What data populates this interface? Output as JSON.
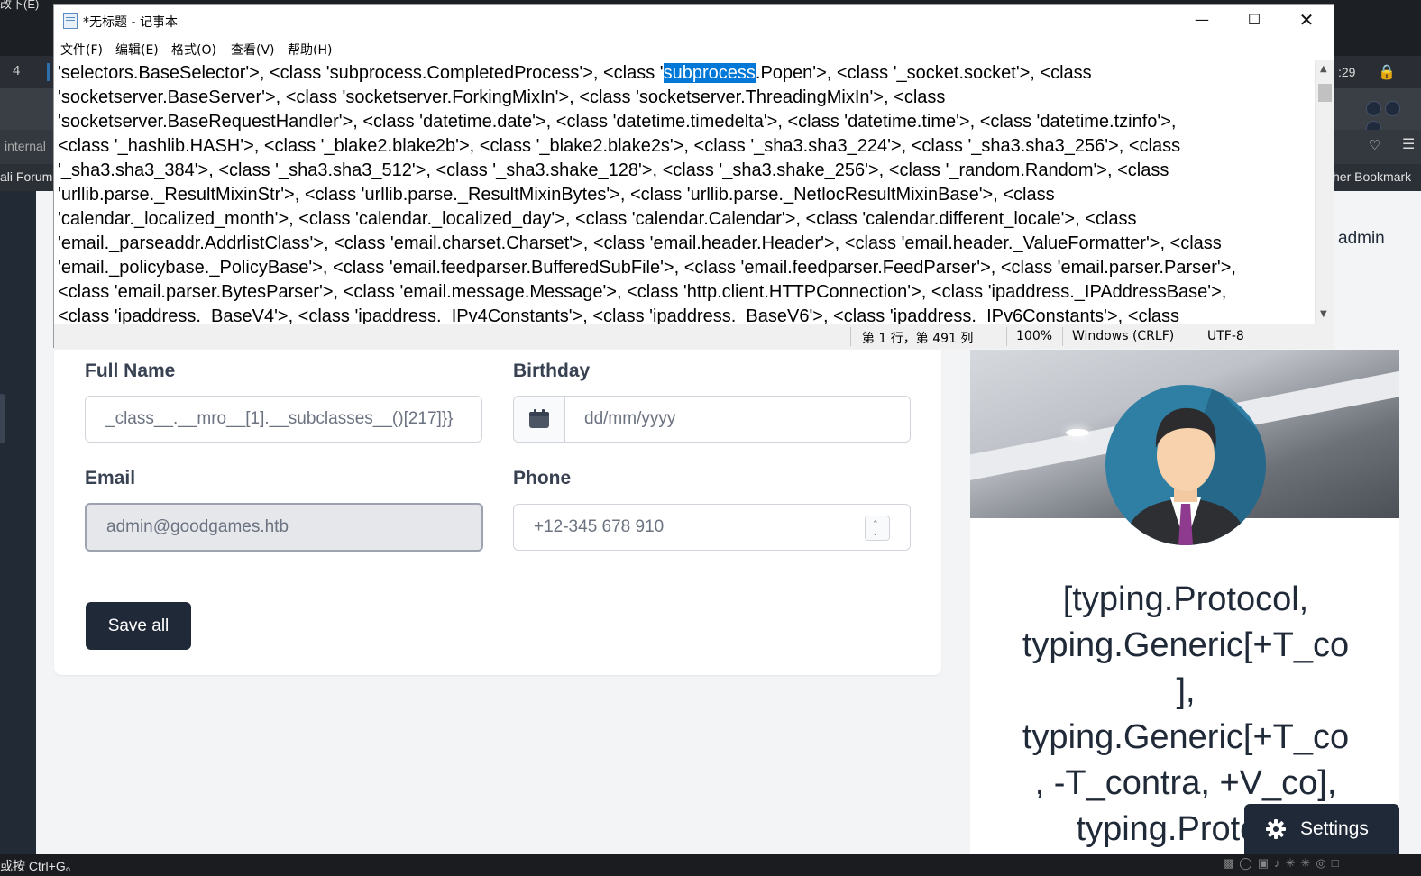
{
  "background_browser": {
    "top_fragment": "改下(E)",
    "tab_number": "4",
    "clock_fragment": ":29",
    "url_fragment": "internal",
    "bookmark_left": "ali Forum",
    "bookmark_right": "her Bookmark",
    "admin_label": "admin",
    "status_hint": "或按 Ctrl+G。"
  },
  "profile_form": {
    "full_name": {
      "label": "Full Name",
      "value": "_class__.__mro__[1].__subclasses__()[217]}}"
    },
    "birthday": {
      "label": "Birthday",
      "placeholder": "dd/mm/yyyy"
    },
    "email": {
      "label": "Email",
      "value": "admin@goodgames.htb"
    },
    "phone": {
      "label": "Phone",
      "value": "+12-345 678 910"
    },
    "save_label": "Save all"
  },
  "profile_card": {
    "lines": [
      "[typing.Protocol,",
      "typing.Generic[+T_co",
      "],",
      "typing.Generic[+T_co",
      ", -T_contra, +V_co],",
      "typing.Protoco"
    ]
  },
  "settings_label": "Settings",
  "notepad": {
    "title": "*无标题 - 记事本",
    "menu": [
      "文件(F)",
      "编辑(E)",
      "格式(O)",
      "查看(V)",
      "帮助(H)"
    ],
    "lines": [
      {
        "before": "'selectors.BaseSelector'>, <class 'subprocess.CompletedProcess'>, <class '",
        "selected": "subprocess",
        "after": ".Popen'>, <class '_socket.socket'>, <class"
      },
      {
        "before": "'socketserver.BaseServer'>, <class 'socketserver.ForkingMixIn'>, <class 'socketserver.ThreadingMixIn'>, <class",
        "selected": "",
        "after": ""
      },
      {
        "before": "'socketserver.BaseRequestHandler'>, <class 'datetime.date'>, <class 'datetime.timedelta'>, <class 'datetime.time'>, <class 'datetime.tzinfo'>,",
        "selected": "",
        "after": ""
      },
      {
        "before": "<class '_hashlib.HASH'>, <class '_blake2.blake2b'>, <class '_blake2.blake2s'>, <class '_sha3.sha3_224'>, <class '_sha3.sha3_256'>, <class",
        "selected": "",
        "after": ""
      },
      {
        "before": "'_sha3.sha3_384'>, <class '_sha3.sha3_512'>, <class '_sha3.shake_128'>, <class '_sha3.shake_256'>, <class '_random.Random'>, <class",
        "selected": "",
        "after": ""
      },
      {
        "before": "'urllib.parse._ResultMixinStr'>, <class 'urllib.parse._ResultMixinBytes'>, <class 'urllib.parse._NetlocResultMixinBase'>, <class",
        "selected": "",
        "after": ""
      },
      {
        "before": "'calendar._localized_month'>, <class 'calendar._localized_day'>, <class 'calendar.Calendar'>, <class 'calendar.different_locale'>, <class",
        "selected": "",
        "after": ""
      },
      {
        "before": "'email._parseaddr.AddrlistClass'>, <class 'email.charset.Charset'>, <class 'email.header.Header'>, <class 'email.header._ValueFormatter'>, <class",
        "selected": "",
        "after": ""
      },
      {
        "before": "'email._policybase._PolicyBase'>, <class 'email.feedparser.BufferedSubFile'>, <class 'email.feedparser.FeedParser'>, <class 'email.parser.Parser'>,",
        "selected": "",
        "after": ""
      },
      {
        "before": "<class 'email.parser.BytesParser'>, <class 'email.message.Message'>, <class 'http.client.HTTPConnection'>, <class 'ipaddress._IPAddressBase'>,",
        "selected": "",
        "after": ""
      },
      {
        "before": "<class 'ipaddress._BaseV4'>, <class 'ipaddress._IPv4Constants'>, <class 'ipaddress._BaseV6'>, <class 'ipaddress._IPv6Constants'>, <class",
        "selected": "",
        "after": ""
      }
    ],
    "status": {
      "position": "第 1 行，第 491 列",
      "zoom": "100%",
      "line_ending": "Windows (CRLF)",
      "encoding": "UTF-8"
    }
  },
  "colors": {
    "selection": "#0078d7",
    "dark_button": "#1f2937",
    "avatar_bg": "#2f7ea3"
  }
}
